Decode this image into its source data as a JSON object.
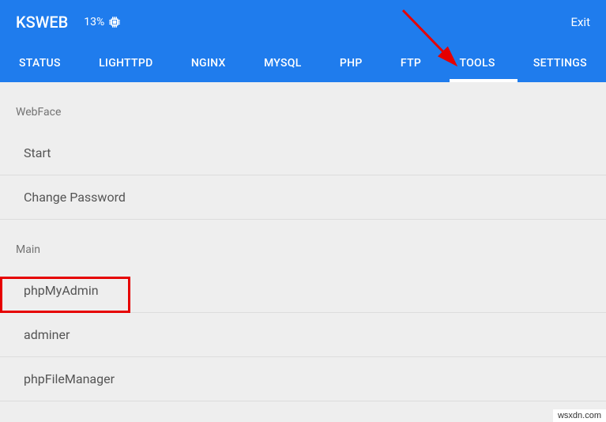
{
  "header": {
    "title": "KSWEB",
    "battery": "13%",
    "exit": "Exit"
  },
  "tabs": [
    "STATUS",
    "LIGHTTPD",
    "NGINX",
    "MYSQL",
    "PHP",
    "FTP",
    "TOOLS",
    "SETTINGS"
  ],
  "active_tab_index": 6,
  "sections": {
    "webface": {
      "header": "WebFace",
      "items": [
        "Start",
        "Change Password"
      ]
    },
    "main": {
      "header": "Main",
      "items": [
        "phpMyAdmin",
        "adminer",
        "phpFileManager"
      ]
    }
  },
  "watermark": "wsxdn.com"
}
